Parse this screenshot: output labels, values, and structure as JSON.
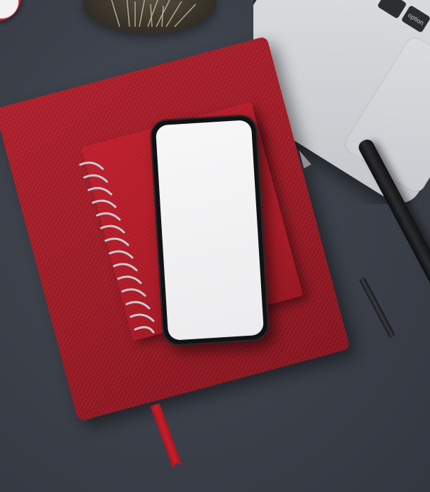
{
  "scene": {
    "description_kind": "photo",
    "laptop": {
      "key_label": "option"
    },
    "colors": {
      "desk": "#3a3f48",
      "notebook": "#9a1a25",
      "spiral_notebook": "#ad1d29",
      "phone_frame": "#111214",
      "phone_screen": "#f3f3f4",
      "laptop": "#d3d6d9",
      "pen": "#151517"
    }
  }
}
